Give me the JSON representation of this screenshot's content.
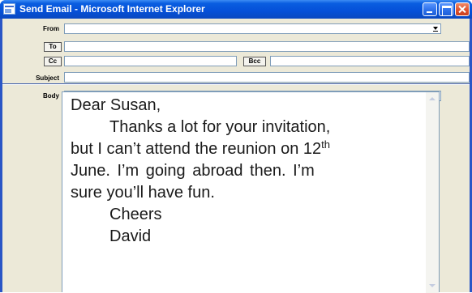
{
  "window": {
    "title": "Send Email - Microsoft Internet Explorer"
  },
  "form": {
    "from_label": "From",
    "from_value": "",
    "to_button": "To",
    "to_value": "",
    "cc_button": "Cc",
    "cc_value": "",
    "bcc_button": "Bcc",
    "bcc_value": "",
    "subject_label": "Subject",
    "subject_value": "",
    "body_label": "Body",
    "body_format_value": ""
  },
  "message": {
    "greeting": "Dear Susan,",
    "line1": "Thanks a lot for your invitation,",
    "line2_before": "but I can’t attend the reunion on 12",
    "line2_sup": "th",
    "line3": "June. I’m going abroad then. I’m",
    "line4": "sure you’ll have fun.",
    "closing": "Cheers",
    "signature": "David"
  },
  "icons": {
    "window_icon": "ie-document-icon",
    "minimize": "minimize-icon",
    "maximize": "maximize-icon",
    "close": "close-icon",
    "dropdown": "chevron-down-icon"
  }
}
